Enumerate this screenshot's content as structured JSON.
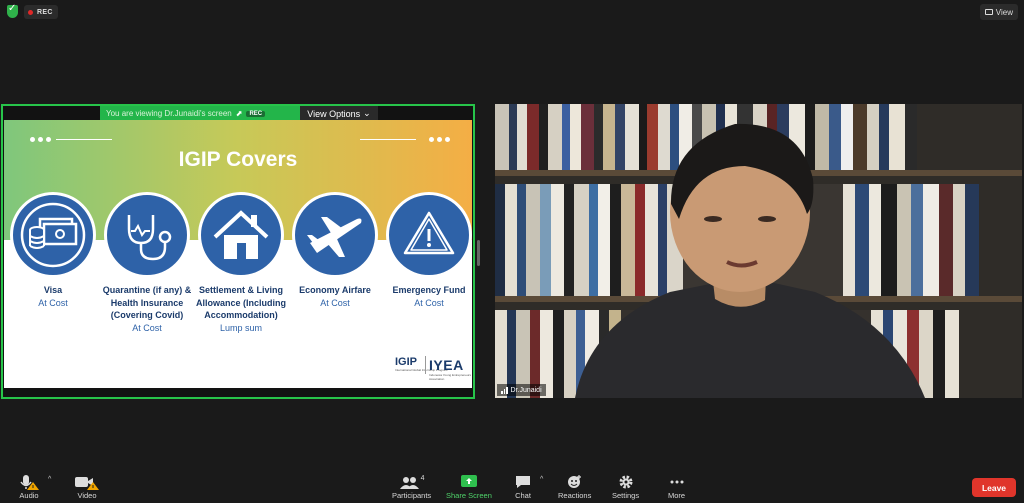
{
  "top_bar": {
    "rec_label": "REC",
    "view_label": "View"
  },
  "share": {
    "banner_text": "You are viewing Dr.Junaidi's screen",
    "banner_rec": "REC",
    "view_options_label": "View Options"
  },
  "slide": {
    "title": "IGIP Covers",
    "items": [
      {
        "title": "Visa",
        "sub": "At Cost",
        "icon": "money-icon"
      },
      {
        "title": "Quarantine (if any) & Health Insurance (Covering Covid)",
        "sub": "At Cost",
        "icon": "stethoscope-icon"
      },
      {
        "title": "Settlement & Living Allowance (Including Accommodation)",
        "sub": "Lump sum",
        "icon": "house-icon"
      },
      {
        "title": "Economy Airfare",
        "sub": "At Cost",
        "icon": "airplane-icon"
      },
      {
        "title": "Emergency Fund",
        "sub": "At Cost",
        "icon": "warning-icon"
      }
    ],
    "logo_igip": "IGIP",
    "logo_igip_tagline": "International Global Internship Program",
    "logo_iyea": "IYEA",
    "logo_iyea_tagline": "Indonesia Young Entrepreneurs Association"
  },
  "video": {
    "name": "Dr.Junaidi"
  },
  "toolbar": {
    "audio": "Audio",
    "video": "Video",
    "participants": "Participants",
    "participants_count": "4",
    "share_screen": "Share Screen",
    "chat": "Chat",
    "reactions": "Reactions",
    "settings": "Settings",
    "more": "More",
    "leave": "Leave"
  },
  "colors": {
    "accent_green": "#27c44a",
    "leave_red": "#e0352b",
    "slide_blue": "#2e62a8"
  }
}
